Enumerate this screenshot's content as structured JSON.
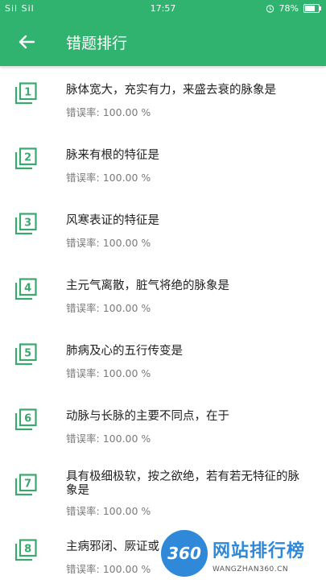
{
  "status_bar": {
    "signal": "Sil Sil",
    "time": "17:57",
    "battery": "78%"
  },
  "toolbar": {
    "title": "错题排行"
  },
  "rate_label": "错误率:",
  "items": [
    {
      "num": "1",
      "title": "脉体宽大，充实有力，来盛去衰的脉象是",
      "rate": "100.00 %"
    },
    {
      "num": "2",
      "title": "脉来有根的特征是",
      "rate": "100.00 %"
    },
    {
      "num": "3",
      "title": "风寒表证的特征是",
      "rate": "100.00 %"
    },
    {
      "num": "4",
      "title": "主元气离散，脏气将绝的脉象是",
      "rate": "100.00 %"
    },
    {
      "num": "5",
      "title": "肺病及心的五行传变是",
      "rate": "100.00 %"
    },
    {
      "num": "6",
      "title": "动脉与长脉的主要不同点，在于",
      "rate": "100.00 %"
    },
    {
      "num": "7",
      "title": "具有极细极软，按之欲绝，若有若无特征的脉象是",
      "rate": "100.00 %"
    },
    {
      "num": "8",
      "title": "主病邪闭、厥证或",
      "rate": "100.00 %"
    }
  ],
  "watermark": {
    "logo": "360",
    "text": "网站排行榜",
    "sub": "WANGZHAN360.CN"
  },
  "colors": {
    "primary": "#2fb36e",
    "icon": "#3aa86f",
    "watermark": "#2f88d8"
  }
}
